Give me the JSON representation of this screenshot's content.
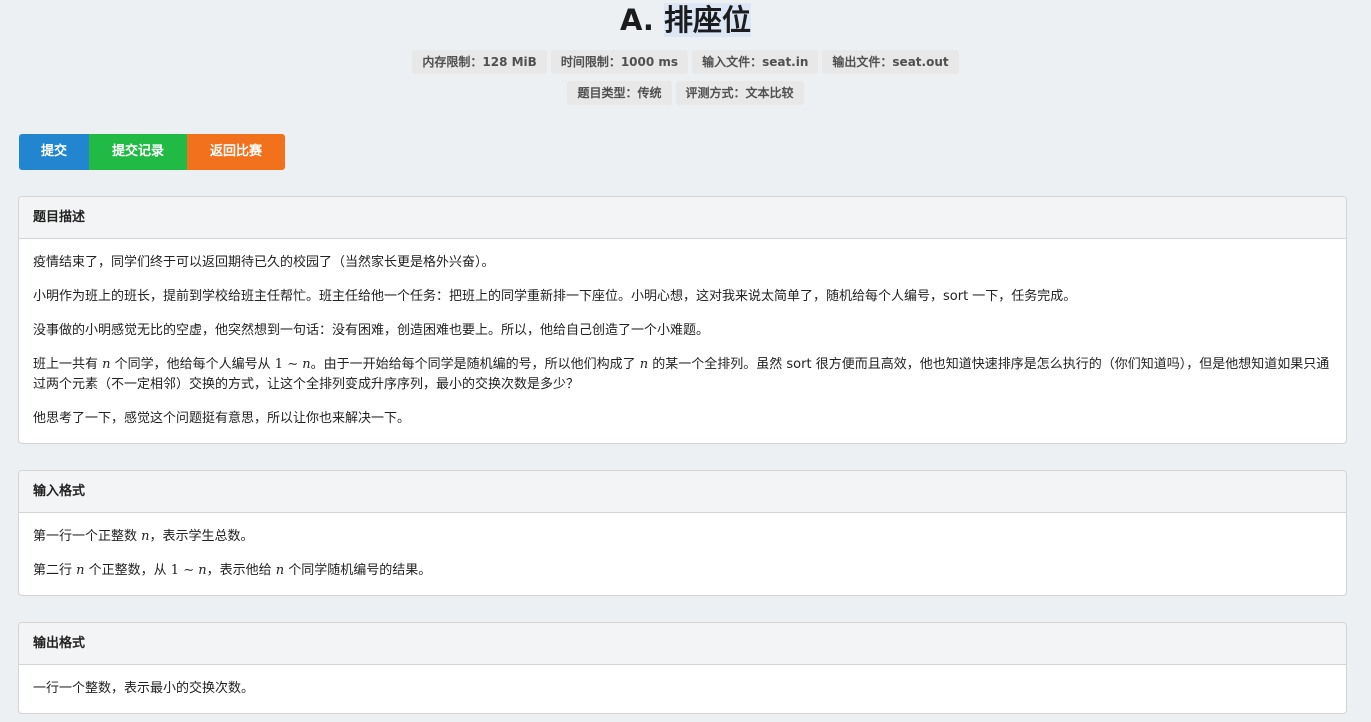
{
  "problem": {
    "title_prefix": "A.",
    "title_name": "排座位",
    "labels_row1": [
      "内存限制：128 MiB",
      "时间限制：1000 ms",
      "输入文件：seat.in",
      "输出文件：seat.out"
    ],
    "labels_row2": [
      "题目类型：传统",
      "评测方式：文本比较"
    ]
  },
  "actions": {
    "submit": "提交",
    "records": "提交记录",
    "back": "返回比赛",
    "colors": {
      "submit": "#2185d0",
      "records": "#21ba45",
      "back": "#f2711c"
    }
  },
  "description": {
    "header": "题目描述",
    "p1": "疫情结束了，同学们终于可以返回期待已久的校园了（当然家长更是格外兴奋）。",
    "p2": "小明作为班上的班长，提前到学校给班主任帮忙。班主任给他一个任务：把班上的同学重新排一下座位。小明心想，这对我来说太简单了，随机给每个人编号，sort 一下，任务完成。",
    "p3": "没事做的小明感觉无比的空虚，他突然想到一句话：没有困难，创造困难也要上。所以，他给自己创造了一个小难题。",
    "p4_a": "班上一共有 ",
    "p4_n1": "n",
    "p4_b": " 个同学，他给每个人编号从 ",
    "p4_one": "1",
    "p4_tilde": " ∼ ",
    "p4_n2": "n",
    "p4_c": "。由于一开始给每个同学是随机编的号，所以他们构成了 ",
    "p4_n3": "n",
    "p4_d": " 的某一个全排列。虽然 sort 很方便而且高效，他也知道快速排序是怎么执行的（你们知道吗），但是他想知道如果只通过两个元素（不一定相邻）交换的方式，让这个全排列变成升序序列，最小的交换次数是多少？",
    "p5": "他思考了一下，感觉这个问题挺有意思，所以让你也来解决一下。"
  },
  "input": {
    "header": "输入格式",
    "l1_a": "第一行一个正整数 ",
    "l1_n": "n",
    "l1_b": "，表示学生总数。",
    "l2_a": "第二行 ",
    "l2_n1": "n",
    "l2_b": " 个正整数，从 ",
    "l2_one": "1",
    "l2_tilde": " ∼ ",
    "l2_n2": "n",
    "l2_c": "，表示他给 ",
    "l2_n3": "n",
    "l2_d": " 个同学随机编号的结果。"
  },
  "output": {
    "header": "输出格式",
    "l1": "一行一个整数，表示最小的交换次数。"
  }
}
